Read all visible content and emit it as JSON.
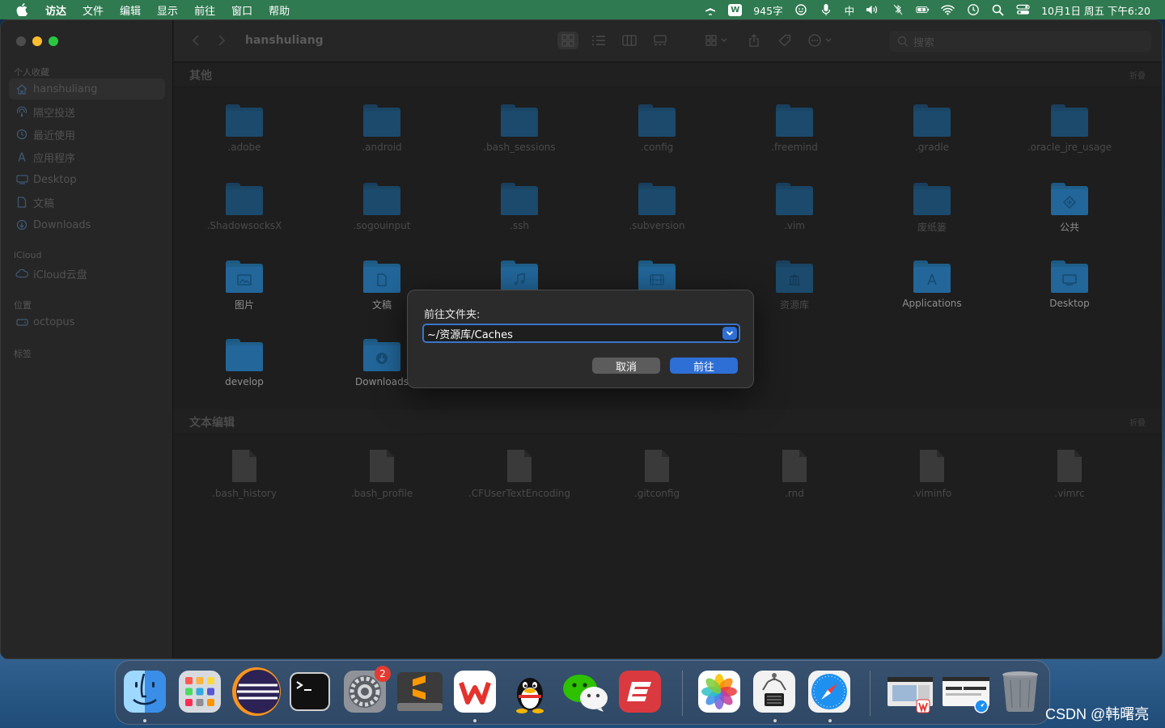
{
  "menubar": {
    "app_name": "访达",
    "items": [
      "文件",
      "编辑",
      "显示",
      "前往",
      "窗口",
      "帮助"
    ],
    "word_count": "945字",
    "ime": "中",
    "datetime": "10月1日 周五 下午6:20"
  },
  "sidebar": {
    "sections": {
      "favorites": "个人收藏",
      "icloud": "iCloud",
      "locations": "位置",
      "tags": "标签"
    },
    "favorites": [
      {
        "label": "hanshuliang",
        "icon": "home-icon"
      },
      {
        "label": "隔空投送",
        "icon": "airdrop-icon"
      },
      {
        "label": "最近使用",
        "icon": "clock-icon"
      },
      {
        "label": "应用程序",
        "icon": "apps-icon"
      },
      {
        "label": "Desktop",
        "icon": "desktop-icon"
      },
      {
        "label": "文稿",
        "icon": "document-icon"
      },
      {
        "label": "Downloads",
        "icon": "download-icon"
      }
    ],
    "icloud_items": [
      {
        "label": "iCloud云盘",
        "icon": "cloud-icon"
      }
    ],
    "location_items": [
      {
        "label": "octopus",
        "icon": "drive-icon"
      }
    ]
  },
  "toolbar": {
    "title": "hanshuliang",
    "search_placeholder": "搜索"
  },
  "groups": {
    "other": {
      "title": "其他",
      "collapse": "折叠"
    },
    "text": {
      "title": "文本编辑",
      "collapse": "折叠"
    }
  },
  "other_items": [
    ".adobe",
    ".android",
    ".bash_sessions",
    ".config",
    ".freemind",
    ".gradle",
    ".oracle_jre_usage",
    ".ShadowsocksX",
    ".sogouinput",
    ".ssh",
    ".subversion",
    ".vim",
    "废纸篓",
    "公共",
    "图片",
    "文稿",
    "",
    "",
    "资源库",
    "Applications",
    "Desktop",
    "develop",
    "Downloads"
  ],
  "text_items": [
    ".bash_history",
    ".bash_profile",
    ".CFUserTextEncoding",
    ".gitconfig",
    ".rnd",
    ".viminfo",
    ".vimrc"
  ],
  "dialog": {
    "title": "前往文件夹:",
    "value": "~/资源库/Caches",
    "cancel": "取消",
    "go": "前往"
  },
  "dock": {
    "settings_badge": "2"
  },
  "watermark": "CSDN @韩曙亮"
}
